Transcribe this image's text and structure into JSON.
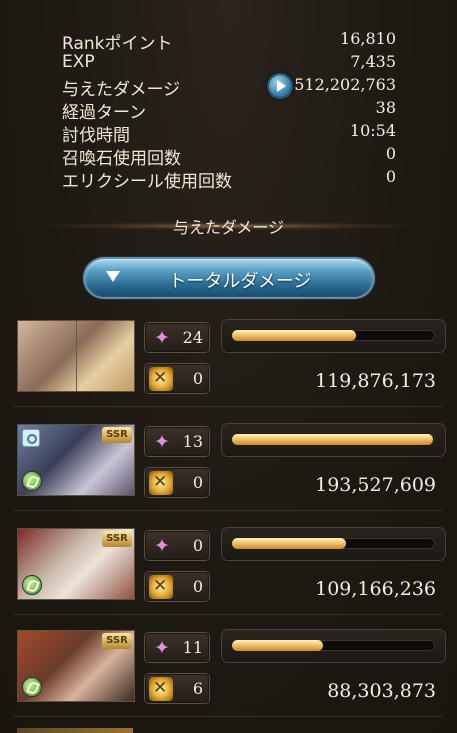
{
  "stats": [
    {
      "label": "Rankポイント",
      "value": "16,810"
    },
    {
      "label": "EXP",
      "value": "7,435"
    },
    {
      "label": "与えたダメージ",
      "value": "512,202,763"
    },
    {
      "label": "経過ターン",
      "value": "38"
    },
    {
      "label": "討伐時間",
      "value": "10:54"
    },
    {
      "label": "召喚石使用回数",
      "value": "0"
    },
    {
      "label": "エリクシール使用回数",
      "value": "0"
    }
  ],
  "section_title": "与えたダメージ",
  "total_button_label": "トータルダメージ",
  "characters": [
    {
      "star_count": "24",
      "burst_count": "0",
      "damage": "119,876,173",
      "bar_fill": 0.61,
      "ssr": "",
      "element": ""
    },
    {
      "star_count": "13",
      "burst_count": "0",
      "damage": "193,527,609",
      "bar_fill": 0.99,
      "ssr": "SSR",
      "element": "wind"
    },
    {
      "star_count": "0",
      "burst_count": "0",
      "damage": "109,166,236",
      "bar_fill": 0.56,
      "ssr": "SSR",
      "element": "wind"
    },
    {
      "star_count": "11",
      "burst_count": "6",
      "damage": "88,303,873",
      "bar_fill": 0.45,
      "ssr": "SSR",
      "element": "wind"
    }
  ],
  "colors": {
    "bar_fill": "#f2c46b",
    "accent_blue": "#3a7fa6",
    "background": "#1f1a15"
  }
}
